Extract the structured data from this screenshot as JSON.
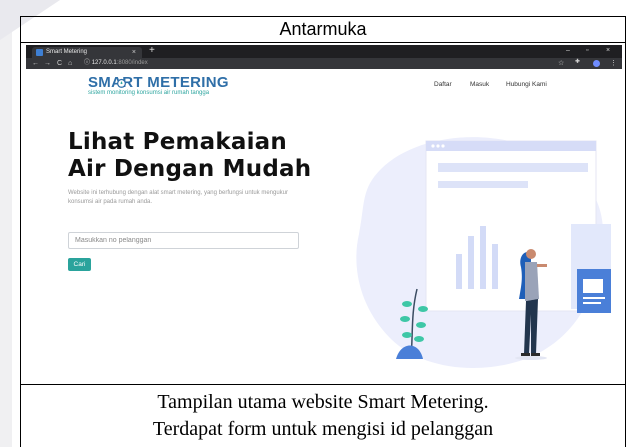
{
  "doc": {
    "header": "Antarmuka",
    "caption_line1": "Tampilan utama website Smart Metering.",
    "caption_line2": "Terdapat form untuk mengisi id pelanggan"
  },
  "browser": {
    "tab_title": "Smart Metering",
    "tab_close": "×",
    "new_tab": "+",
    "url_host": "127.0.0.1",
    "url_path": ":8080/index",
    "back": "←",
    "forward": "→",
    "reload": "C",
    "home": "⌂",
    "info": "ⓘ",
    "minimize": "–",
    "maximize": "▫",
    "close": "×",
    "star": "☆",
    "menu": "⋮"
  },
  "site": {
    "logo": "SMART METERING",
    "tagline": "sistem monitoring konsumsi air rumah tangga",
    "nav": [
      "Daftar",
      "Masuk",
      "Hubungi Kami"
    ],
    "hero_line1": "Lihat Pemakaian",
    "hero_line2": "Air Dengan Mudah",
    "hero_desc": "Website ini terhubung dengan alat smart metering, yang berfungsi untuk mengukur konsumsi air pada rumah anda.",
    "search_placeholder": "Masukkan no pelanggan",
    "search_button": "Cari"
  },
  "colors": {
    "brand_blue": "#2f6fa8",
    "accent_teal": "#2aa39c",
    "illustration_blue": "#4a7fd8",
    "illustration_lilac": "#eceefc"
  },
  "icons": [
    "favicon-icon",
    "back-arrow-icon",
    "forward-arrow-icon",
    "reload-icon",
    "home-icon",
    "info-icon",
    "star-icon",
    "extension-icon",
    "profile-avatar-icon",
    "kebab-menu-icon",
    "water-drop-icon"
  ]
}
